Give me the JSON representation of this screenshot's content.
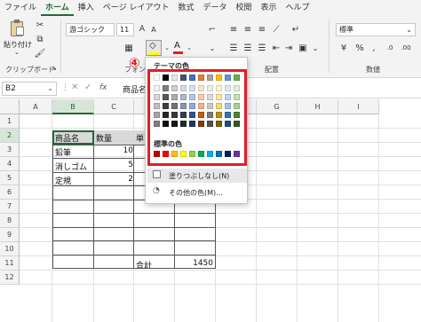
{
  "menu": [
    "ファイル",
    "ホーム",
    "挿入",
    "ページ レイアウト",
    "数式",
    "データ",
    "校閲",
    "表示",
    "ヘルプ"
  ],
  "ribbon": {
    "paste_label": "貼り付け",
    "clipboard_label": "クリップボード",
    "font_name": "游ゴシック",
    "font_size": "11",
    "font_group_label": "フォント",
    "align_group_label": "配置",
    "number_format": "標準",
    "number_group_label": "数値"
  },
  "formula_bar": {
    "name_box": "B2",
    "fx": "fx",
    "content": "商品名"
  },
  "grid": {
    "columns": [
      "A",
      "B",
      "C",
      "D",
      "E",
      "F",
      "G",
      "H",
      "I"
    ],
    "rows": [
      "1",
      "2",
      "3",
      "4",
      "5",
      "6",
      "7",
      "8",
      "9",
      "10",
      "11",
      "12"
    ],
    "cells": {
      "B2": "商品名",
      "C2": "数量",
      "D2": "単",
      "B3": "鉛筆",
      "C3": "10",
      "B4": "消しゴム",
      "C4": "5",
      "B5": "定規",
      "C5": "2",
      "D11": "合計",
      "E11": "1450"
    }
  },
  "palette": {
    "step_marker": "④",
    "theme_label": "テーマの色",
    "standard_label": "標準の色",
    "no_fill": "塗りつぶしなし(N)",
    "more_colors": "その他の色(M)...",
    "theme_base": [
      "#ffffff",
      "#000000",
      "#e7e6e6",
      "#44546a",
      "#4472c4",
      "#ed7d31",
      "#a5a5a5",
      "#ffc000",
      "#5b9bd5",
      "#70ad47"
    ],
    "theme_shades": [
      [
        "#f2f2f2",
        "#7f7f7f",
        "#d0cece",
        "#d6dce4",
        "#d9e2f3",
        "#fbe5d5",
        "#ededed",
        "#fff2cc",
        "#deebf6",
        "#e2efd9"
      ],
      [
        "#d8d8d8",
        "#595959",
        "#aeaaaa",
        "#acb9ca",
        "#b4c6e7",
        "#f7cbac",
        "#dbdbdb",
        "#fee599",
        "#bdd7ee",
        "#c5e0b3"
      ],
      [
        "#bfbfbf",
        "#3f3f3f",
        "#757171",
        "#8496b0",
        "#8eaadb",
        "#f4b183",
        "#c9c9c9",
        "#ffd965",
        "#9dc3e6",
        "#a8d08d"
      ],
      [
        "#a5a5a5",
        "#262626",
        "#3a3838",
        "#333f4f",
        "#2f5496",
        "#c55a11",
        "#7b7b7b",
        "#bf9000",
        "#2e75b5",
        "#538135"
      ],
      [
        "#7f7f7f",
        "#0d0d0d",
        "#171616",
        "#222a35",
        "#1f3864",
        "#833c0b",
        "#525252",
        "#7f6000",
        "#1e4e79",
        "#375623"
      ]
    ],
    "standard_colors": [
      "#c00000",
      "#ff0000",
      "#ffc000",
      "#ffff00",
      "#92d050",
      "#00b050",
      "#00b0f0",
      "#0070c0",
      "#002060",
      "#7030a0"
    ]
  },
  "colors": {
    "accent": "#1e6b37",
    "highlight": "#e01e26",
    "header_fill": "#d9d9d9"
  }
}
